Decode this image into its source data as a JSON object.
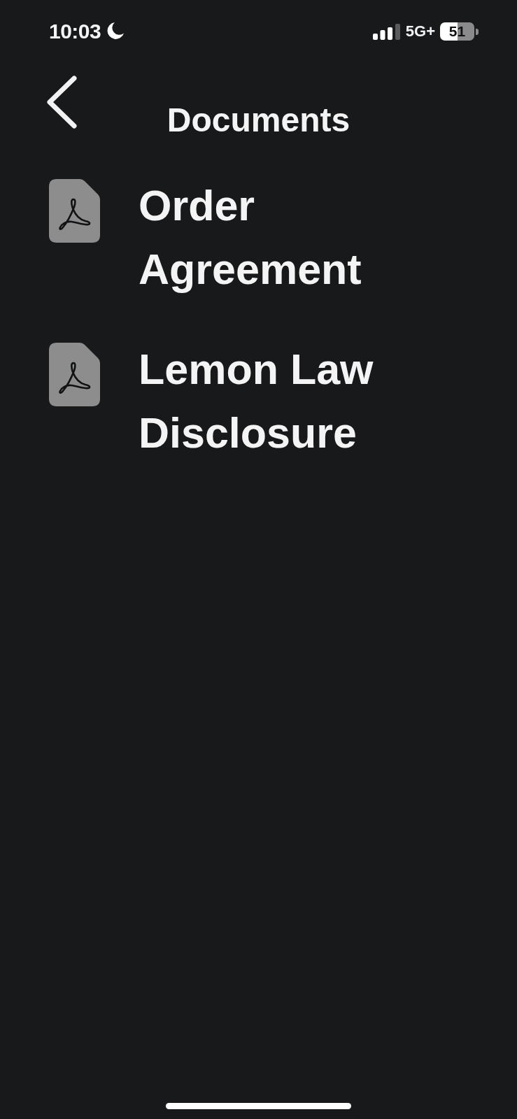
{
  "status_bar": {
    "time": "10:03",
    "network": "5G+",
    "battery": "51"
  },
  "header": {
    "title": "Documents"
  },
  "documents": [
    {
      "name": "Order Agreement"
    },
    {
      "name": "Lemon Law Disclosure"
    }
  ]
}
